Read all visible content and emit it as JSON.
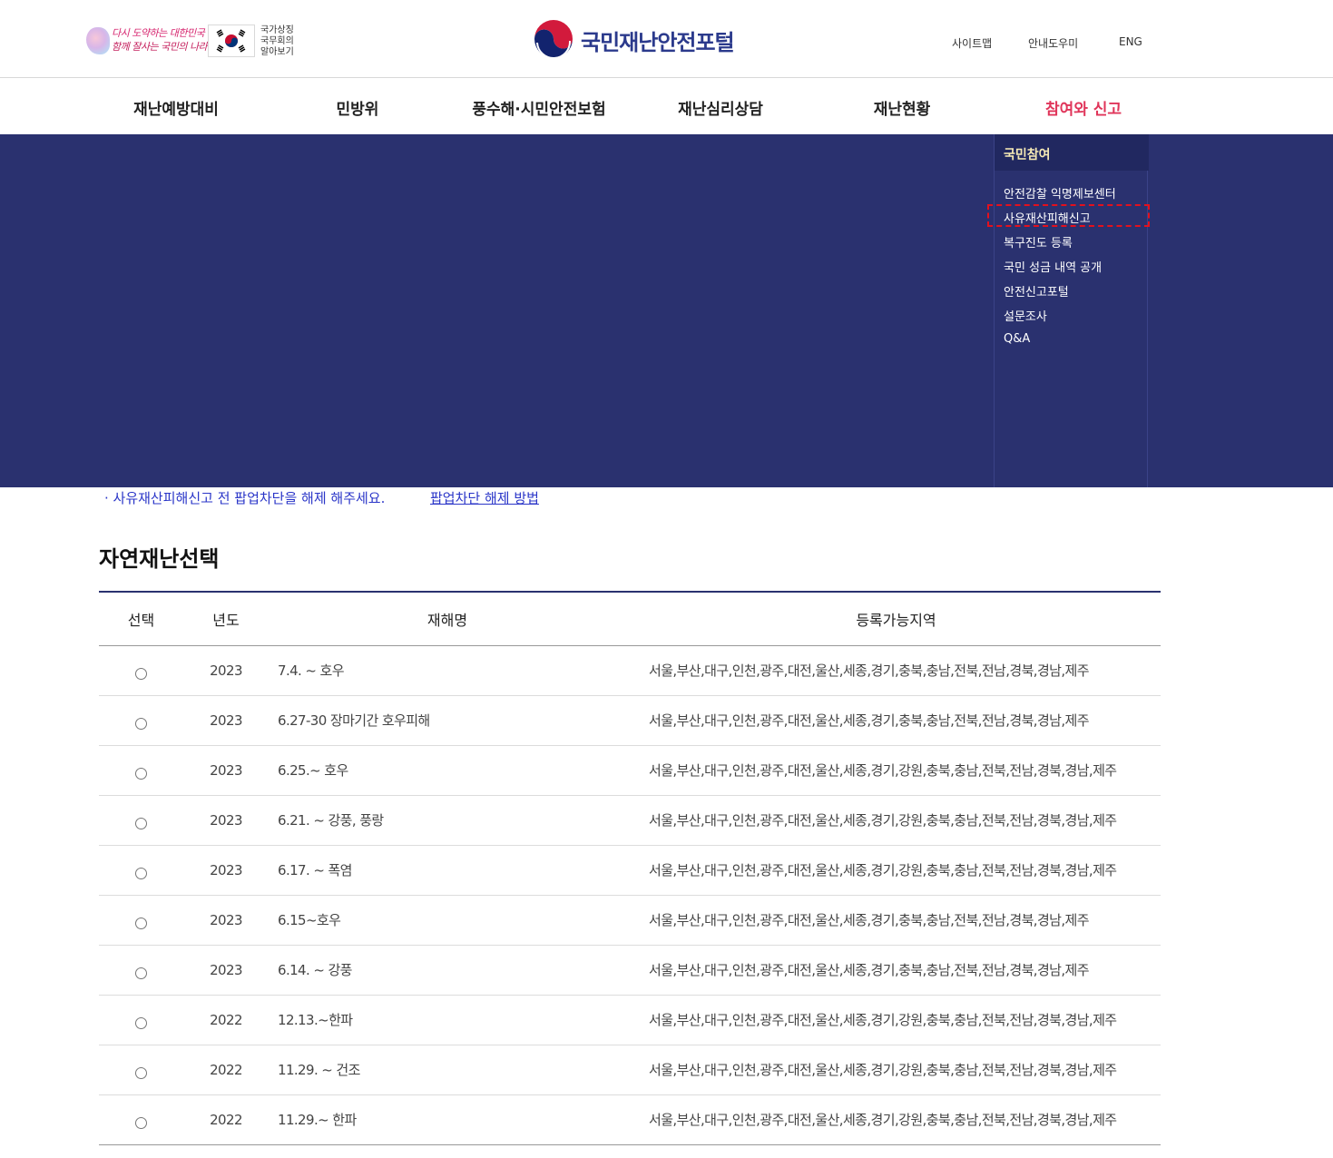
{
  "header": {
    "slogan_line1": "다시 도약하는 대한민국",
    "slogan_line2": "함께 잘사는 국민의 나라",
    "national_symbols": [
      "국가상징",
      "국무회의",
      "알아보기"
    ],
    "logo_text": "국민재난안전포털",
    "utils": {
      "sitemap": "사이트맵",
      "help": "안내도우미",
      "eng": "ENG"
    }
  },
  "gnb": [
    {
      "label": "재난예방대비"
    },
    {
      "label": "민방위"
    },
    {
      "label": "풍수해·시민안전보험"
    },
    {
      "label": "재난심리상담"
    },
    {
      "label": "재난현황"
    },
    {
      "label": "참여와 신고"
    }
  ],
  "submenu": {
    "title": "국민참여",
    "items": [
      {
        "label": "안전감찰 익명제보센터"
      },
      {
        "label": "사유재산피해신고"
      },
      {
        "label": "복구진도 등록"
      },
      {
        "label": "국민 성금 내역 공개"
      },
      {
        "label": "안전신고포털"
      },
      {
        "label": "설문조사"
      },
      {
        "label": "Q&A"
      }
    ]
  },
  "notice": {
    "text": "· 사유재산피해신고 전 팝업차단을 해제 해주세요.",
    "link": "팝업차단 해제 방법"
  },
  "section_title": "자연재난선택",
  "table": {
    "headers": {
      "select": "선택",
      "year": "년도",
      "name": "재해명",
      "area": "등록가능지역"
    },
    "rows": [
      {
        "year": "2023",
        "name": "7.4. ~ 호우",
        "area": "서울,부산,대구,인천,광주,대전,울산,세종,경기,충북,충남,전북,전남,경북,경남,제주"
      },
      {
        "year": "2023",
        "name": "6.27-30 장마기간 호우피해",
        "area": "서울,부산,대구,인천,광주,대전,울산,세종,경기,충북,충남,전북,전남,경북,경남,제주"
      },
      {
        "year": "2023",
        "name": "6.25.~ 호우",
        "area": "서울,부산,대구,인천,광주,대전,울산,세종,경기,강원,충북,충남,전북,전남,경북,경남,제주"
      },
      {
        "year": "2023",
        "name": "6.21. ~ 강풍, 풍랑",
        "area": "서울,부산,대구,인천,광주,대전,울산,세종,경기,강원,충북,충남,전북,전남,경북,경남,제주"
      },
      {
        "year": "2023",
        "name": "6.17. ~ 폭염",
        "area": "서울,부산,대구,인천,광주,대전,울산,세종,경기,강원,충북,충남,전북,전남,경북,경남,제주"
      },
      {
        "year": "2023",
        "name": "6.15~호우",
        "area": "서울,부산,대구,인천,광주,대전,울산,세종,경기,충북,충남,전북,전남,경북,경남,제주"
      },
      {
        "year": "2023",
        "name": "6.14. ~ 강풍",
        "area": "서울,부산,대구,인천,광주,대전,울산,세종,경기,충북,충남,전북,전남,경북,경남,제주"
      },
      {
        "year": "2022",
        "name": "12.13.~한파",
        "area": "서울,부산,대구,인천,광주,대전,울산,세종,경기,강원,충북,충남,전북,전남,경북,경남,제주"
      },
      {
        "year": "2022",
        "name": "11.29. ~ 건조",
        "area": "서울,부산,대구,인천,광주,대전,울산,세종,경기,강원,충북,충남,전북,전남,경북,경남,제주"
      },
      {
        "year": "2022",
        "name": "11.29.~ 한파",
        "area": "서울,부산,대구,인천,광주,대전,울산,세종,경기,강원,충북,충남,전북,전남,경북,경남,제주"
      }
    ]
  },
  "colors": {
    "navy": "#2a316f",
    "accent_red": "#e0355a",
    "link_blue": "#2a35c8",
    "highlight_dash": "#e4101d"
  }
}
